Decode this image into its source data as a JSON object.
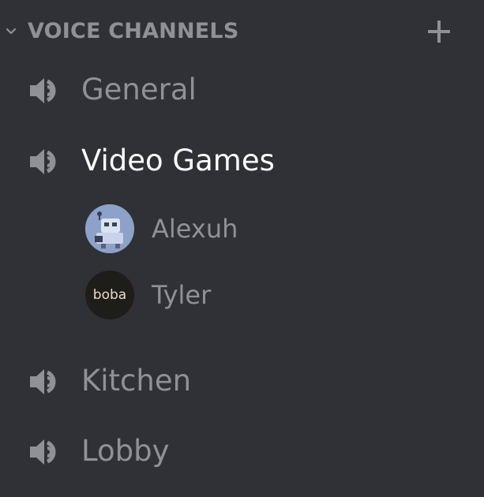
{
  "category": {
    "label": "VOICE CHANNELS",
    "chevron_icon": "chevron-down-icon",
    "add_icon": "plus-icon"
  },
  "channels": [
    {
      "name": "General",
      "icon": "speaker-icon",
      "active": false
    },
    {
      "name": "Video Games",
      "icon": "speaker-icon",
      "active": true
    },
    {
      "name": "Kitchen",
      "icon": "speaker-icon",
      "active": false
    },
    {
      "name": "Lobby",
      "icon": "speaker-icon",
      "active": false
    }
  ],
  "voice_users": [
    {
      "name": "Alexuh",
      "avatar": "robot-avatar"
    },
    {
      "name": "Tyler",
      "avatar_text": "boba"
    }
  ],
  "colors": {
    "background": "#2f3136",
    "muted_text": "#8e9297",
    "active_text": "#ffffff",
    "icon": "#8e9297"
  }
}
